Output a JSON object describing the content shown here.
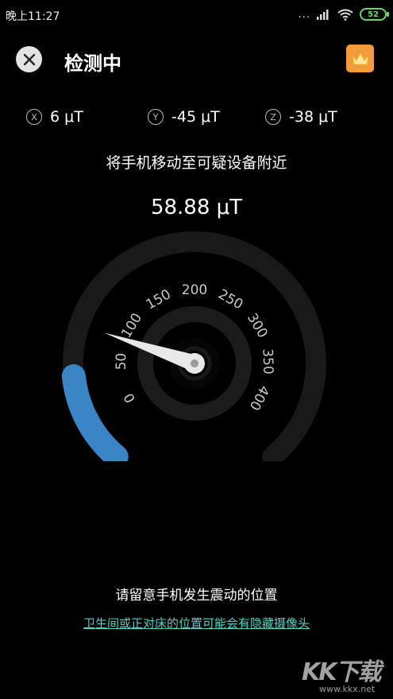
{
  "status_bar": {
    "time": "晚上11:27",
    "dots": "...",
    "battery": "52"
  },
  "header": {
    "title": "检测中"
  },
  "axes": [
    {
      "symbol": "X",
      "value": "6 μT"
    },
    {
      "symbol": "Y",
      "value": "-45 μT"
    },
    {
      "symbol": "Z",
      "value": "-38 μT"
    }
  ],
  "instruction": "将手机移动至可疑设备附近",
  "reading": "58.88 μT",
  "gauge": {
    "ticks": [
      "0",
      "50",
      "100",
      "150",
      "200",
      "250",
      "300",
      "350",
      "400"
    ],
    "value": 58.88,
    "max": 400,
    "colors": {
      "track": "#191919",
      "fill": "#3a85c8",
      "needle": "#e8e8e8"
    }
  },
  "footer": {
    "tip": "请留意手机发生震动的位置",
    "link": "卫生间或正对床的位置可能会有隐藏摄像头"
  },
  "watermark": {
    "text": "KK下载",
    "url": "www.kkx.net"
  }
}
